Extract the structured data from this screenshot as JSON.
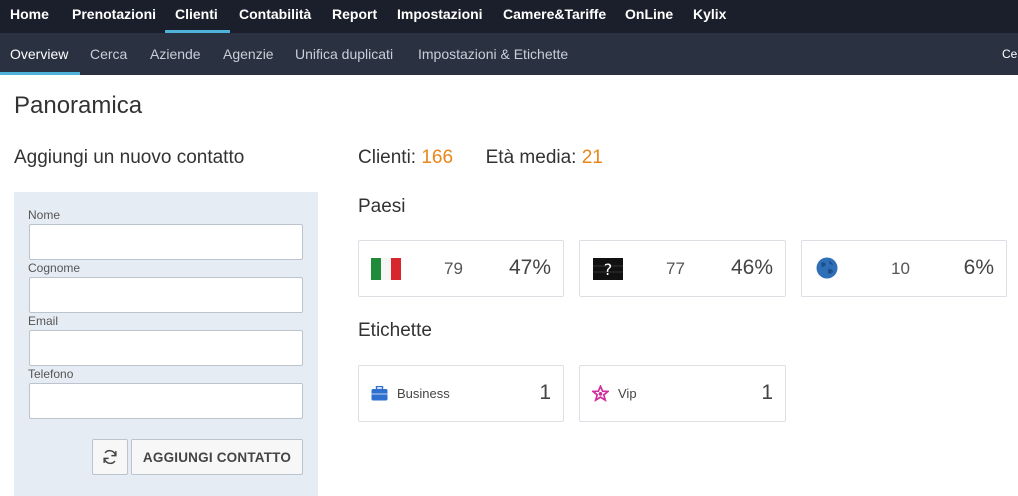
{
  "topnav": {
    "items": [
      {
        "label": "Home"
      },
      {
        "label": "Prenotazioni"
      },
      {
        "label": "Clienti"
      },
      {
        "label": "Contabilità"
      },
      {
        "label": "Report"
      },
      {
        "label": "Impostazioni"
      },
      {
        "label": "Camere&Tariffe"
      },
      {
        "label": "OnLine"
      },
      {
        "label": "Kylix"
      }
    ],
    "active": "Clienti"
  },
  "subnav": {
    "items": [
      {
        "label": "Overview"
      },
      {
        "label": "Cerca"
      },
      {
        "label": "Aziende"
      },
      {
        "label": "Agenzie"
      },
      {
        "label": "Unifica duplicati"
      },
      {
        "label": "Impostazioni & Etichette"
      }
    ],
    "active": "Overview",
    "right_cut": "Cer"
  },
  "page": {
    "title": "Panoramica"
  },
  "form": {
    "title": "Aggiungi un nuovo contatto",
    "fields": [
      {
        "label": "Nome",
        "value": ""
      },
      {
        "label": "Cognome",
        "value": ""
      },
      {
        "label": "Email",
        "value": ""
      },
      {
        "label": "Telefono",
        "value": ""
      }
    ],
    "submit_label": "AGGIUNGI CONTATTO",
    "refresh_icon": "refresh-icon"
  },
  "stats": {
    "clienti_label": "Clienti:",
    "clienti_value": "166",
    "eta_label": "Età media:",
    "eta_value": "21",
    "accent_color": "#e8861a"
  },
  "paesi": {
    "title": "Paesi",
    "cards": [
      {
        "icon": "italy-flag-icon",
        "count": "79",
        "pct": "47%"
      },
      {
        "icon": "unknown-flag-icon",
        "count": "77",
        "pct": "46%"
      },
      {
        "icon": "globe-icon",
        "count": "10",
        "pct": "6%"
      }
    ]
  },
  "etichette": {
    "title": "Etichette",
    "cards": [
      {
        "icon": "briefcase-icon",
        "label": "Business",
        "count": "1",
        "color": "#2f6fd0"
      },
      {
        "icon": "star-icon",
        "label": "Vip",
        "count": "1",
        "color": "#d02c9a"
      }
    ]
  }
}
